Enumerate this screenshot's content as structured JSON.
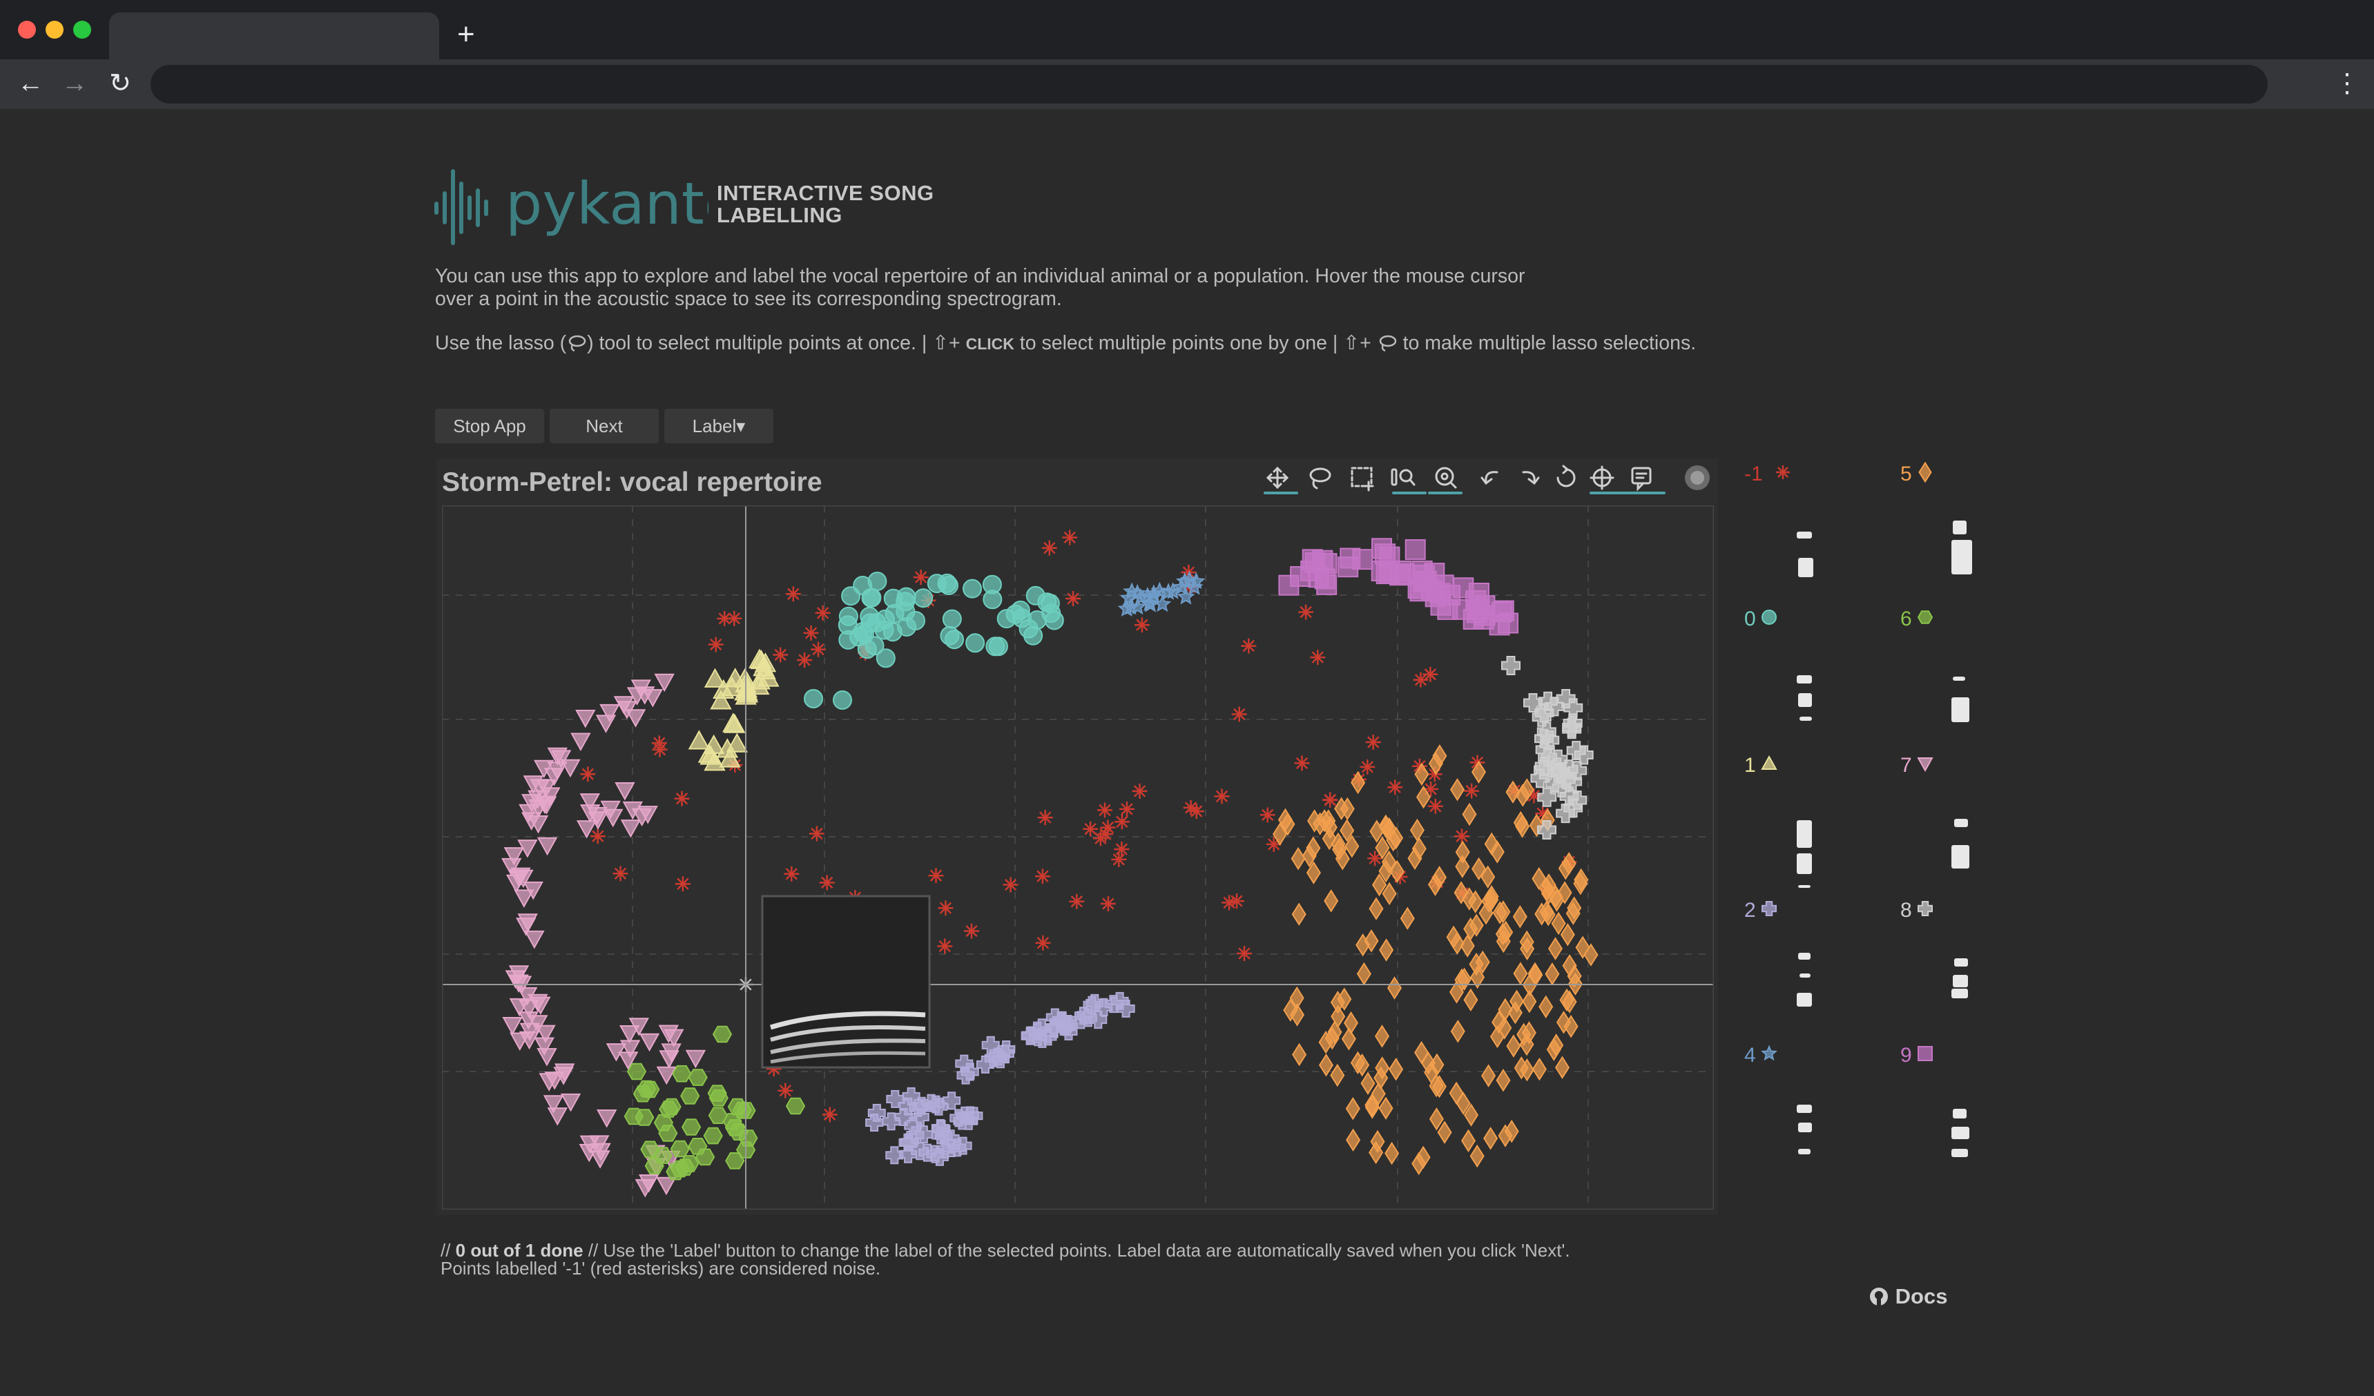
{
  "app": {
    "brand": "pykanto",
    "subtitle": "INTERACTIVE SONG LABELLING",
    "intro": "You can use this app to explore and label the vocal repertoire of an individual animal or a population. Hover the mouse cursor over a point in the acoustic space to see its corresponding spectrogram.",
    "help": {
      "part1": "Use the lasso (",
      "part2": ") tool to select multiple points at once. | ⇧+ ",
      "click_label": "CLICK",
      "part3": " to select multiple points one by one | ⇧+ ",
      "part4": " to make multiple lasso selections."
    }
  },
  "buttons": {
    "stop": "Stop App",
    "next": "Next",
    "label": "Label▾"
  },
  "plot": {
    "title": "Storm-Petrel: vocal repertoire"
  },
  "footer": {
    "prefix": "// ",
    "status": "0 out of 1 done",
    "line1_rest": " // Use the 'Label' button to change the label of the selected points. Label data are automatically saved when you click 'Next'.",
    "line2": "Points labelled '-1' (red asterisks) are considered noise."
  },
  "docs": {
    "label": "Docs"
  },
  "colors": {
    "noise": "#cc3a2e",
    "c0": "#6ecfbf",
    "c1": "#e9e29a",
    "c2": "#b1acd9",
    "c4": "#6f9cc9",
    "c5": "#f29f4d",
    "c6": "#8ac34a",
    "c7": "#e6a7cb",
    "c8": "#cfcfcf",
    "c9": "#c676c6"
  },
  "chart_data": {
    "type": "scatter",
    "title": "Storm-Petrel: vocal repertoire",
    "xlabel": "",
    "ylabel": "",
    "grid": true,
    "clusters": [
      {
        "label": "-1",
        "marker": "asterisk",
        "color": "#cc3a2e"
      },
      {
        "label": "0",
        "marker": "circle",
        "color": "#6ecfbf"
      },
      {
        "label": "1",
        "marker": "triangle",
        "color": "#e9e29a"
      },
      {
        "label": "2",
        "marker": "plus",
        "color": "#b1acd9"
      },
      {
        "label": "4",
        "marker": "star",
        "color": "#6f9cc9"
      },
      {
        "label": "5",
        "marker": "diamond",
        "color": "#f29f4d"
      },
      {
        "label": "6",
        "marker": "hexagon",
        "color": "#8ac34a"
      },
      {
        "label": "7",
        "marker": "inverted-triangle",
        "color": "#e6a7cb"
      },
      {
        "label": "8",
        "marker": "plus",
        "color": "#cfcfcf"
      },
      {
        "label": "9",
        "marker": "square",
        "color": "#c676c6"
      }
    ]
  }
}
